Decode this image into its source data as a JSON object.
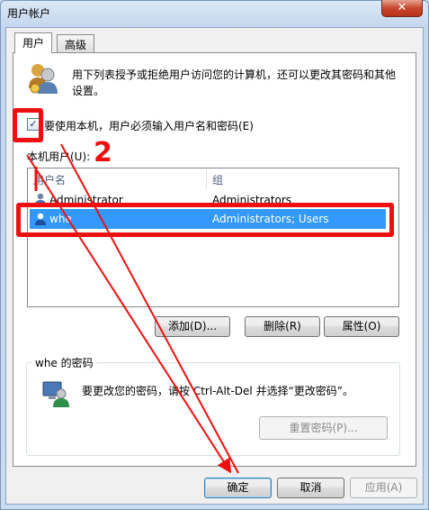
{
  "window": {
    "title": "用户帐户",
    "close_glyph": "✕"
  },
  "tabs": [
    {
      "label": "用户"
    },
    {
      "label": "高级"
    }
  ],
  "intro_line1": "用下列表授予或拒绝用户访问您的计算机，还可以更改其密码和其他",
  "intro_line2": "设置。",
  "require_password": {
    "checked": true,
    "check_glyph": "✓",
    "label": "要使用本机，用户必须输入用户名和密码(E)"
  },
  "local_users_label": "本机用户(U):",
  "user_list": {
    "columns": [
      "用户名",
      "组"
    ],
    "rows": [
      {
        "name": "Administrator",
        "group": "Administrators"
      },
      {
        "name": "whe",
        "group": "Administrators; Users",
        "selected": true
      }
    ]
  },
  "list_buttons": {
    "add": "添加(D)...",
    "remove": "删除(R)",
    "properties": "属性(O)"
  },
  "password_group": {
    "title": "whe 的密码",
    "text": "要更改您的密码，请按 Ctrl-Alt-Del 并选择“更改密码”。",
    "reset_button": "重置密码(P)..."
  },
  "dialog_buttons": {
    "ok": "确定",
    "cancel": "取消",
    "apply": "应用(A)"
  },
  "annotation": {
    "number": "2"
  },
  "colors": {
    "selection": "#3399ff",
    "annotation_red": "#ee1010"
  }
}
